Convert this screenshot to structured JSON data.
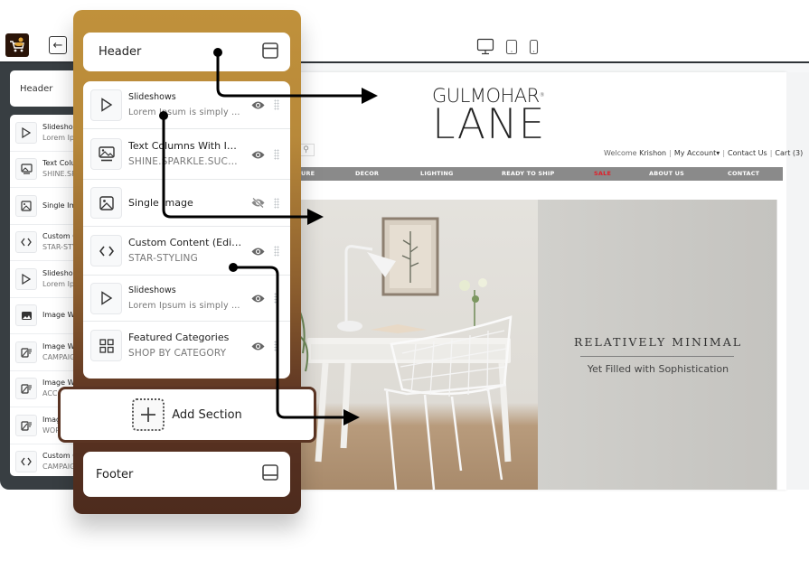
{
  "app": {
    "logo_icon": "shopping-cart-logo-icon",
    "back_icon": "arrow-left-icon",
    "device_modes": [
      {
        "name": "desktop",
        "icon": "desktop-icon",
        "active": true
      },
      {
        "name": "tablet",
        "icon": "tablet-icon",
        "active": false
      },
      {
        "name": "mobile",
        "icon": "mobile-icon",
        "active": false
      }
    ]
  },
  "left_sidebar": {
    "header_label": "Header",
    "items": [
      {
        "title": "Slideshows",
        "subtitle": "Lorem Ips",
        "icon": "play-icon"
      },
      {
        "title": "Text Colu",
        "subtitle": "SHINE.SP",
        "icon": "image-text-icon"
      },
      {
        "title": "Single Im",
        "subtitle": "",
        "icon": "image-icon"
      },
      {
        "title": "Custom C",
        "subtitle": "STAR-STY",
        "icon": "code-icon"
      },
      {
        "title": "Slideshow",
        "subtitle": "Lorem Ips",
        "icon": "play-icon"
      },
      {
        "title": "Image Wi",
        "subtitle": "",
        "icon": "image-icon"
      },
      {
        "title": "Image Wi",
        "subtitle": "CAMPAIG",
        "icon": "image-list-icon"
      },
      {
        "title": "Image Wi",
        "subtitle": "ACC",
        "icon": "image-list-icon"
      },
      {
        "title": "Imag",
        "subtitle": "WOR",
        "icon": "image-list-icon"
      },
      {
        "title": "Custom C",
        "subtitle": "CAMPAIG",
        "icon": "code-icon"
      }
    ]
  },
  "panel": {
    "header": {
      "label": "Header",
      "icon": "layout-header-icon"
    },
    "sections": [
      {
        "title": "Slideshows",
        "subtitle": "Lorem Ipsum is simply du...",
        "icon": "play-icon",
        "visible": true
      },
      {
        "title": "Text Columns With Ima...",
        "subtitle": "SHINE.SPARKLE.SUCCEED",
        "icon": "image-text-icon",
        "visible": true
      },
      {
        "title": "Single Image",
        "subtitle": "",
        "icon": "image-icon",
        "visible": false
      },
      {
        "title": "Custom Content (Editor)",
        "subtitle": "STAR-STYLING",
        "icon": "code-icon",
        "visible": true
      },
      {
        "title": "Slideshows",
        "subtitle": "Lorem Ipsum is simply du...",
        "icon": "play-icon",
        "visible": true
      },
      {
        "title": "Featured Categories",
        "subtitle": "SHOP BY CATEGORY",
        "icon": "grid-icon",
        "visible": true
      }
    ],
    "add_section_label": "Add Section",
    "footer": {
      "label": "Footer",
      "icon": "layout-footer-icon"
    }
  },
  "preview": {
    "brand_top": "GULMOHAR",
    "brand_reg": "®",
    "brand_bottom": "LANE",
    "account": {
      "welcome": "Welcome",
      "user": "Krishon",
      "my_account": "My Account▾",
      "contact": "Contact Us",
      "cart": "Cart (3)"
    },
    "nav": [
      {
        "label": "URE",
        "color": "#ffffff"
      },
      {
        "label": "DECOR",
        "color": "#ffffff"
      },
      {
        "label": "LIGHTING",
        "color": "#ffffff"
      },
      {
        "label": "READY TO SHIP",
        "color": "#ffffff"
      },
      {
        "label": "SALE",
        "color": "#e0202a"
      },
      {
        "label": "ABOUT US",
        "color": "#ffffff"
      },
      {
        "label": "CONTACT",
        "color": "#ffffff"
      }
    ],
    "hero": {
      "title": "RELATIVELY MINIMAL",
      "subtitle": "Yet Filled with Sophistication"
    }
  },
  "colors": {
    "panel_top": "#c0913b",
    "panel_bottom": "#4d2b1d",
    "sidebar_dark": "#383e42",
    "nav_bar": "#8a8a8a",
    "sale_red": "#e0202a"
  }
}
